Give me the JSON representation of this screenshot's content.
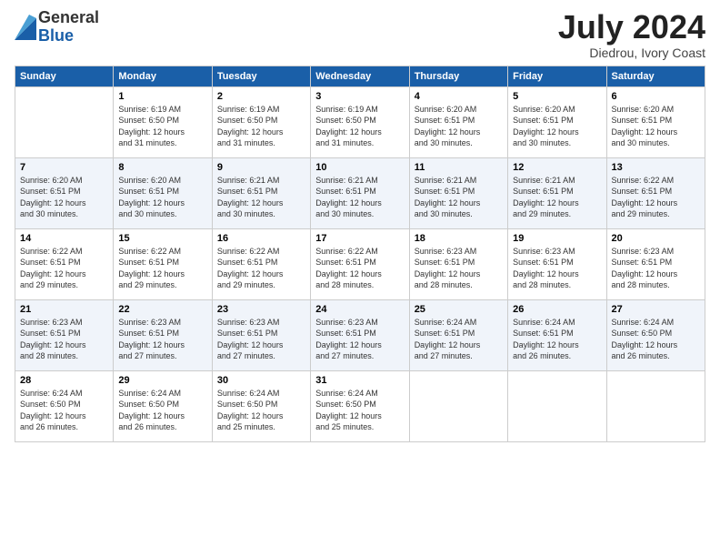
{
  "logo": {
    "general": "General",
    "blue": "Blue"
  },
  "title": "July 2024",
  "location": "Diedrou, Ivory Coast",
  "days_of_week": [
    "Sunday",
    "Monday",
    "Tuesday",
    "Wednesday",
    "Thursday",
    "Friday",
    "Saturday"
  ],
  "weeks": [
    [
      {
        "day": "",
        "info": ""
      },
      {
        "day": "1",
        "info": "Sunrise: 6:19 AM\nSunset: 6:50 PM\nDaylight: 12 hours\nand 31 minutes."
      },
      {
        "day": "2",
        "info": "Sunrise: 6:19 AM\nSunset: 6:50 PM\nDaylight: 12 hours\nand 31 minutes."
      },
      {
        "day": "3",
        "info": "Sunrise: 6:19 AM\nSunset: 6:50 PM\nDaylight: 12 hours\nand 31 minutes."
      },
      {
        "day": "4",
        "info": "Sunrise: 6:20 AM\nSunset: 6:51 PM\nDaylight: 12 hours\nand 30 minutes."
      },
      {
        "day": "5",
        "info": "Sunrise: 6:20 AM\nSunset: 6:51 PM\nDaylight: 12 hours\nand 30 minutes."
      },
      {
        "day": "6",
        "info": "Sunrise: 6:20 AM\nSunset: 6:51 PM\nDaylight: 12 hours\nand 30 minutes."
      }
    ],
    [
      {
        "day": "7",
        "info": "Sunrise: 6:20 AM\nSunset: 6:51 PM\nDaylight: 12 hours\nand 30 minutes."
      },
      {
        "day": "8",
        "info": "Sunrise: 6:20 AM\nSunset: 6:51 PM\nDaylight: 12 hours\nand 30 minutes."
      },
      {
        "day": "9",
        "info": "Sunrise: 6:21 AM\nSunset: 6:51 PM\nDaylight: 12 hours\nand 30 minutes."
      },
      {
        "day": "10",
        "info": "Sunrise: 6:21 AM\nSunset: 6:51 PM\nDaylight: 12 hours\nand 30 minutes."
      },
      {
        "day": "11",
        "info": "Sunrise: 6:21 AM\nSunset: 6:51 PM\nDaylight: 12 hours\nand 30 minutes."
      },
      {
        "day": "12",
        "info": "Sunrise: 6:21 AM\nSunset: 6:51 PM\nDaylight: 12 hours\nand 29 minutes."
      },
      {
        "day": "13",
        "info": "Sunrise: 6:22 AM\nSunset: 6:51 PM\nDaylight: 12 hours\nand 29 minutes."
      }
    ],
    [
      {
        "day": "14",
        "info": "Sunrise: 6:22 AM\nSunset: 6:51 PM\nDaylight: 12 hours\nand 29 minutes."
      },
      {
        "day": "15",
        "info": "Sunrise: 6:22 AM\nSunset: 6:51 PM\nDaylight: 12 hours\nand 29 minutes."
      },
      {
        "day": "16",
        "info": "Sunrise: 6:22 AM\nSunset: 6:51 PM\nDaylight: 12 hours\nand 29 minutes."
      },
      {
        "day": "17",
        "info": "Sunrise: 6:22 AM\nSunset: 6:51 PM\nDaylight: 12 hours\nand 28 minutes."
      },
      {
        "day": "18",
        "info": "Sunrise: 6:23 AM\nSunset: 6:51 PM\nDaylight: 12 hours\nand 28 minutes."
      },
      {
        "day": "19",
        "info": "Sunrise: 6:23 AM\nSunset: 6:51 PM\nDaylight: 12 hours\nand 28 minutes."
      },
      {
        "day": "20",
        "info": "Sunrise: 6:23 AM\nSunset: 6:51 PM\nDaylight: 12 hours\nand 28 minutes."
      }
    ],
    [
      {
        "day": "21",
        "info": "Sunrise: 6:23 AM\nSunset: 6:51 PM\nDaylight: 12 hours\nand 28 minutes."
      },
      {
        "day": "22",
        "info": "Sunrise: 6:23 AM\nSunset: 6:51 PM\nDaylight: 12 hours\nand 27 minutes."
      },
      {
        "day": "23",
        "info": "Sunrise: 6:23 AM\nSunset: 6:51 PM\nDaylight: 12 hours\nand 27 minutes."
      },
      {
        "day": "24",
        "info": "Sunrise: 6:23 AM\nSunset: 6:51 PM\nDaylight: 12 hours\nand 27 minutes."
      },
      {
        "day": "25",
        "info": "Sunrise: 6:24 AM\nSunset: 6:51 PM\nDaylight: 12 hours\nand 27 minutes."
      },
      {
        "day": "26",
        "info": "Sunrise: 6:24 AM\nSunset: 6:51 PM\nDaylight: 12 hours\nand 26 minutes."
      },
      {
        "day": "27",
        "info": "Sunrise: 6:24 AM\nSunset: 6:50 PM\nDaylight: 12 hours\nand 26 minutes."
      }
    ],
    [
      {
        "day": "28",
        "info": "Sunrise: 6:24 AM\nSunset: 6:50 PM\nDaylight: 12 hours\nand 26 minutes."
      },
      {
        "day": "29",
        "info": "Sunrise: 6:24 AM\nSunset: 6:50 PM\nDaylight: 12 hours\nand 26 minutes."
      },
      {
        "day": "30",
        "info": "Sunrise: 6:24 AM\nSunset: 6:50 PM\nDaylight: 12 hours\nand 25 minutes."
      },
      {
        "day": "31",
        "info": "Sunrise: 6:24 AM\nSunset: 6:50 PM\nDaylight: 12 hours\nand 25 minutes."
      },
      {
        "day": "",
        "info": ""
      },
      {
        "day": "",
        "info": ""
      },
      {
        "day": "",
        "info": ""
      }
    ]
  ]
}
